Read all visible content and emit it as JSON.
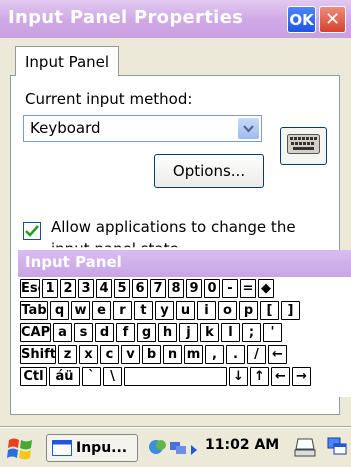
{
  "window": {
    "title": "Input Panel Properties",
    "ok_label": "OK",
    "close_label": "✕"
  },
  "tab": {
    "label": "Input Panel"
  },
  "form": {
    "current_method_label": "Current input method:",
    "dropdown_value": "Keyboard",
    "options_label": "Options...",
    "checkbox_label": "Allow applications to change the",
    "checkbox_label_line2": "input panel state",
    "checkbox_checked": true
  },
  "sip": {
    "title": "Input Panel",
    "rows": [
      [
        "Esc",
        "1",
        "2",
        "3",
        "4",
        "5",
        "6",
        "7",
        "8",
        "9",
        "0",
        "-",
        "=",
        "◆"
      ],
      [
        "Tab",
        "q",
        "w",
        "e",
        "r",
        "t",
        "y",
        "u",
        "i",
        "o",
        "p",
        "[",
        "]"
      ],
      [
        "CAP",
        "a",
        "s",
        "d",
        "f",
        "g",
        "h",
        "j",
        "k",
        "l",
        ";",
        "'"
      ],
      [
        "Shift",
        "z",
        "x",
        "c",
        "v",
        "b",
        "n",
        "m",
        ",",
        ".",
        "/",
        "←"
      ],
      [
        "Ctl",
        "áü",
        "`",
        "\\",
        "",
        "↓",
        "↑",
        "←",
        "→"
      ]
    ]
  },
  "taskbar": {
    "task_label": "Inpu...",
    "clock": "11:02 AM"
  },
  "colors": {
    "accent": "#1f55e0",
    "title_bar": "#cfa8e6",
    "check_green": "#21a121"
  },
  "icons": {
    "start": "windows-flag-icon",
    "keyboard": "keyboard-icon",
    "dropdown": "chevron-down-icon",
    "sync": "activesync-icon",
    "network": "network-icon",
    "sip_tray": "input-panel-icon",
    "desktop": "show-desktop-icon"
  }
}
